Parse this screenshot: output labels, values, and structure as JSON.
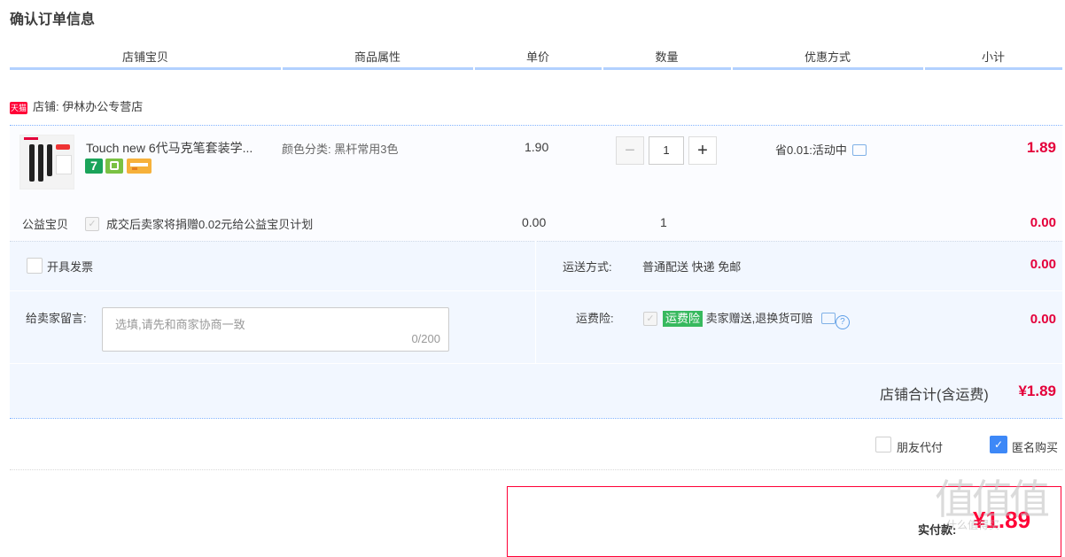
{
  "title": "确认订单信息",
  "columns": [
    "店铺宝贝",
    "商品属性",
    "单价",
    "数量",
    "优惠方式",
    "小计"
  ],
  "shop": {
    "badge": "天猫",
    "label": "店铺: 伊林办公专营店"
  },
  "item": {
    "title": "Touch new 6代马克笔套装学...",
    "attribute": "颜色分类: 黑杆常用3色",
    "unit_price": "1.90",
    "quantity": "1",
    "promo": "省0.01:活动中",
    "subtotal": "1.89",
    "badge_7": "7",
    "badges": [
      "seven-day-return-icon",
      "delivery-guarantee-icon",
      "credit-card-icon"
    ]
  },
  "charity": {
    "label": "公益宝贝",
    "text": "成交后卖家将捐赠0.02元给公益宝贝计划",
    "price": "0.00",
    "quantity": "1",
    "subtotal": "0.00"
  },
  "invoice": {
    "label": "开具发票"
  },
  "shipping": {
    "label": "运送方式:",
    "value": "普通配送 快递 免邮",
    "price": "0.00"
  },
  "message": {
    "label": "给卖家留言:",
    "placeholder": "选填,请先和商家协商一致",
    "counter": "0/200"
  },
  "insurance": {
    "label": "运费险:",
    "tag": "运费险",
    "text": "卖家赠送,退换货可赔",
    "price": "0.00"
  },
  "shop_total": {
    "label": "店铺合计(含运费)",
    "value": "¥1.89"
  },
  "options": {
    "friend_pay": "朋友代付",
    "anonymous": "匿名购买"
  },
  "payment": {
    "label": "实付款:",
    "value": "¥1.89"
  },
  "watermark": {
    "text": "值值值",
    "sub": "什么值得买"
  },
  "colors": {
    "accent_red": "#e4003a",
    "header_line": "#b2d1ff",
    "panel_bg": "#f2f7ff"
  }
}
